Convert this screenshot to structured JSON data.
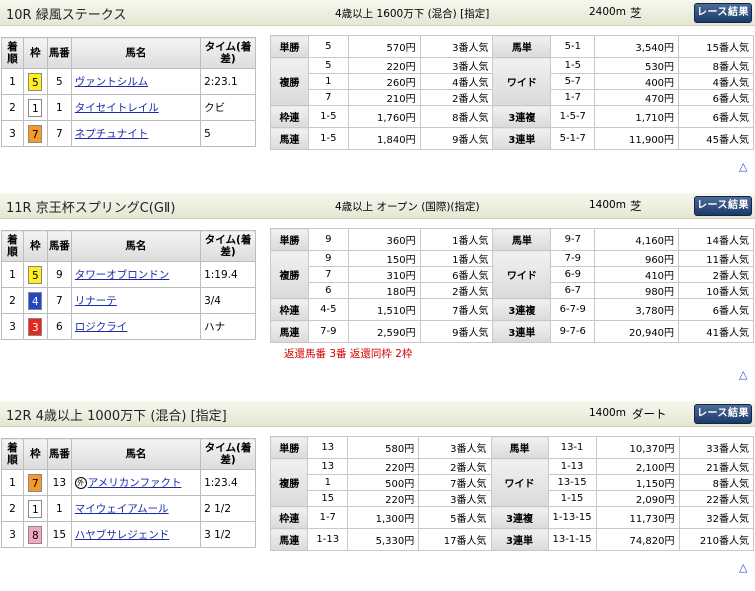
{
  "result_button": "レース結果",
  "up_symbol": "△",
  "result_head": [
    "着順",
    "枠",
    "馬番",
    "馬名",
    "タイム(着差)"
  ],
  "races": [
    {
      "title": "10R 緑風ステークス",
      "cond": "4歳以上 1600万下 (混合) [指定]",
      "dist": "2400m",
      "surface": "芝",
      "rows": [
        {
          "rank": "1",
          "waku": "5",
          "umaban": "5",
          "name": "ヴァントシルム",
          "time": "2:23.1"
        },
        {
          "rank": "2",
          "waku": "1",
          "umaban": "1",
          "name": "タイセイトレイル",
          "time": "クビ"
        },
        {
          "rank": "3",
          "waku": "7",
          "umaban": "7",
          "name": "ネプチュナイト",
          "time": "5"
        }
      ],
      "pay": [
        [
          "単勝",
          "5",
          "570円",
          "3番人気",
          "馬単",
          "5-1",
          "3,540円",
          "15番人気"
        ],
        [
          "複勝",
          "5",
          "220円",
          "3番人気",
          "",
          "1-5",
          "530円",
          "8番人気"
        ],
        [
          "",
          "1",
          "260円",
          "4番人気",
          "ワイド",
          "5-7",
          "400円",
          "4番人気"
        ],
        [
          "",
          "7",
          "210円",
          "2番人気",
          "",
          "1-7",
          "470円",
          "6番人気"
        ],
        [
          "枠連",
          "1-5",
          "1,760円",
          "8番人気",
          "3連複",
          "1-5-7",
          "1,710円",
          "6番人気"
        ],
        [
          "馬連",
          "1-5",
          "1,840円",
          "9番人気",
          "3連単",
          "5-1-7",
          "11,900円",
          "45番人気"
        ]
      ],
      "refund": ""
    },
    {
      "title": "11R 京王杯スプリングC(GⅡ)",
      "cond": "4歳以上 オープン (国際)(指定)",
      "dist": "1400m",
      "surface": "芝",
      "rows": [
        {
          "rank": "1",
          "waku": "5",
          "umaban": "9",
          "name": "タワーオブロンドン",
          "time": "1:19.4"
        },
        {
          "rank": "2",
          "waku": "4",
          "umaban": "7",
          "name": "リナーテ",
          "time": "3/4"
        },
        {
          "rank": "3",
          "waku": "3",
          "umaban": "6",
          "name": "ロジクライ",
          "time": "ハナ"
        }
      ],
      "pay": [
        [
          "単勝",
          "9",
          "360円",
          "1番人気",
          "馬単",
          "9-7",
          "4,160円",
          "14番人気"
        ],
        [
          "複勝",
          "9",
          "150円",
          "1番人気",
          "",
          "7-9",
          "960円",
          "11番人気"
        ],
        [
          "",
          "7",
          "310円",
          "6番人気",
          "ワイド",
          "6-9",
          "410円",
          "2番人気"
        ],
        [
          "",
          "6",
          "180円",
          "2番人気",
          "",
          "6-7",
          "980円",
          "10番人気"
        ],
        [
          "枠連",
          "4-5",
          "1,510円",
          "7番人気",
          "3連複",
          "6-7-9",
          "3,780円",
          "6番人気"
        ],
        [
          "馬連",
          "7-9",
          "2,590円",
          "9番人気",
          "3連単",
          "9-7-6",
          "20,940円",
          "41番人気"
        ]
      ],
      "refund": "返還馬番 3番 返還同枠 2枠"
    },
    {
      "title": "12R 4歳以上 1000万下 (混合) [指定]",
      "cond": "",
      "dist": "1400m",
      "surface": "ダート",
      "rows": [
        {
          "rank": "1",
          "waku": "7",
          "umaban": "13",
          "name": "アメリカンファクト",
          "time": "1:23.4",
          "mark": "外"
        },
        {
          "rank": "2",
          "waku": "1",
          "umaban": "1",
          "name": "マイウェイアムール",
          "time": "2 1/2"
        },
        {
          "rank": "3",
          "waku": "8",
          "umaban": "15",
          "name": "ハヤブサレジェンド",
          "time": "3 1/2"
        }
      ],
      "pay": [
        [
          "単勝",
          "13",
          "580円",
          "3番人気",
          "馬単",
          "13-1",
          "10,370円",
          "33番人気"
        ],
        [
          "複勝",
          "13",
          "220円",
          "2番人気",
          "",
          "1-13",
          "2,100円",
          "21番人気"
        ],
        [
          "",
          "1",
          "500円",
          "7番人気",
          "ワイド",
          "13-15",
          "1,150円",
          "8番人気"
        ],
        [
          "",
          "15",
          "220円",
          "3番人気",
          "",
          "1-15",
          "2,090円",
          "22番人気"
        ],
        [
          "枠連",
          "1-7",
          "1,300円",
          "5番人気",
          "3連複",
          "1-13-15",
          "11,730円",
          "32番人気"
        ],
        [
          "馬連",
          "1-13",
          "5,330円",
          "17番人気",
          "3連単",
          "13-1-15",
          "74,820円",
          "210番人気"
        ]
      ],
      "refund": ""
    }
  ],
  "waku_colors": {
    "1": {
      "bg": "#ffffff",
      "fg": "#000000"
    },
    "2": {
      "bg": "#222222",
      "fg": "#ffffff"
    },
    "3": {
      "bg": "#e8261c",
      "fg": "#ffffff"
    },
    "4": {
      "bg": "#2346c8",
      "fg": "#ffffff"
    },
    "5": {
      "bg": "#ffee22",
      "fg": "#000000"
    },
    "6": {
      "bg": "#2a9a3a",
      "fg": "#ffffff"
    },
    "7": {
      "bg": "#f59a2a",
      "fg": "#000000"
    },
    "8": {
      "bg": "#f4a7c0",
      "fg": "#000000"
    }
  }
}
